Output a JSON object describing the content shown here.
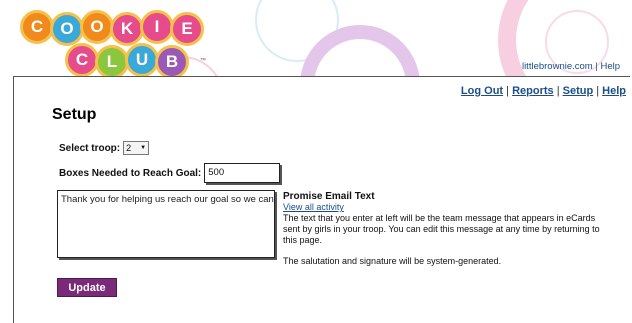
{
  "logo": {
    "row1": [
      "C",
      "O",
      "O",
      "K",
      "I",
      "E"
    ],
    "row2": [
      "C",
      "L",
      "U",
      "B"
    ],
    "trademark": "™",
    "colors_row1": [
      "#f08a1c",
      "#3ba9d8",
      "#f08a1c",
      "#e64b8b",
      "#e64b8b",
      "#e64b8b"
    ],
    "colors_row2": [
      "#e64b8b",
      "#8cc63f",
      "#3ba9d8",
      "#9b59b6"
    ]
  },
  "header_links": {
    "site": "littlebrownie.com",
    "sep": "|",
    "help": "Help"
  },
  "nav": {
    "logout": "Log Out",
    "reports": "Reports",
    "setup": "Setup",
    "help": "Help",
    "sep": "|"
  },
  "page_title": "Setup",
  "troop": {
    "label": "Select troop:",
    "value": "2",
    "arrow": "▼"
  },
  "goal": {
    "label": "Boxes Needed to Reach Goal:",
    "value": "500"
  },
  "message": {
    "value": "Thank you for helping us reach our goal so we can"
  },
  "promise": {
    "title": "Promise Email Text",
    "link": "View all activity",
    "desc": "The text that you enter at left will be the team message that appears in eCards sent by girls in your troop. You can edit this message at any time by returning to this page.",
    "note": "The salutation and signature will be system-generated."
  },
  "update_label": "Update"
}
